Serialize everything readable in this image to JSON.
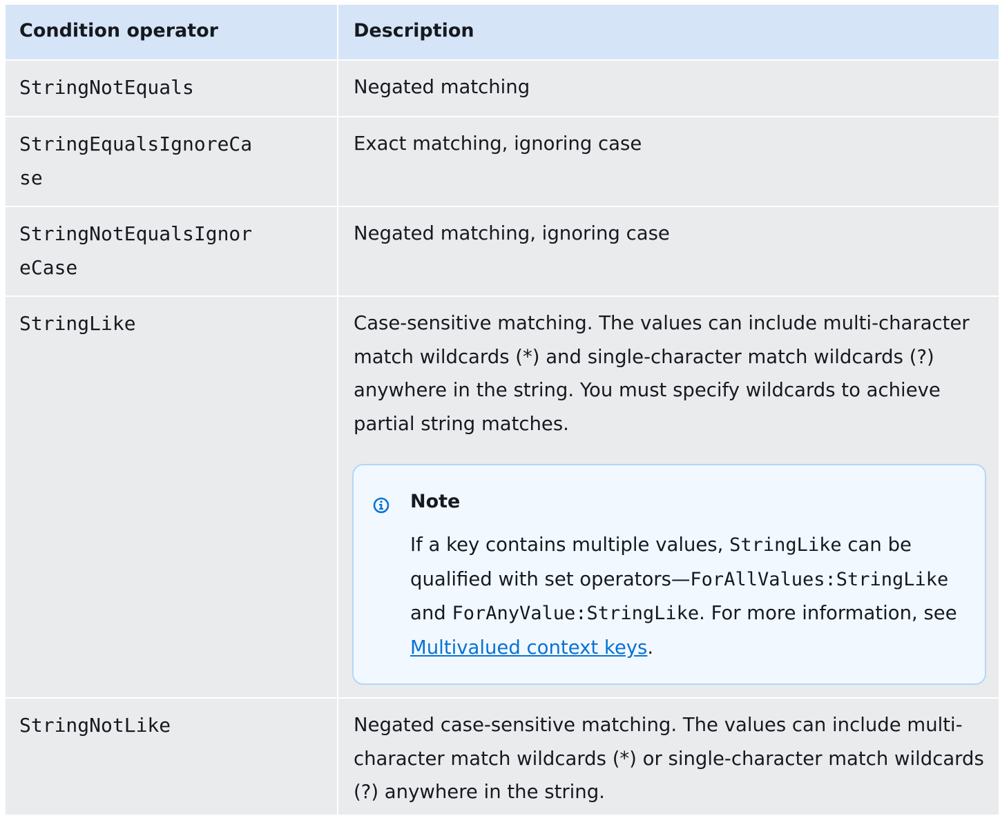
{
  "table": {
    "headers": {
      "operator": "Condition operator",
      "description": "Description"
    },
    "rows": [
      {
        "operator": "StringNotEquals",
        "description": "Negated matching"
      },
      {
        "operator": "StringEqualsIgnoreCase",
        "description": "Exact matching, ignoring case"
      },
      {
        "operator": "StringNotEqualsIgnoreCase",
        "description": "Negated matching, ignoring case"
      },
      {
        "operator": "StringLike",
        "description": "Case-sensitive matching. The values can include multi-character match wildcards (*) and single-character match wildcards (?) anywhere in the string. You must specify wildcards to achieve partial string matches.",
        "note": {
          "icon": "info-icon",
          "title": "Note",
          "text_1": "If a key contains multiple values, ",
          "code_1": "StringLike",
          "text_2": " can be qualified with set operators—",
          "code_2": "ForAllValues:StringLike",
          "text_3": " and ",
          "code_3": "ForAnyValue:StringLike",
          "text_4": ". For more information, see ",
          "link": "Multivalued context keys",
          "text_5": "."
        }
      },
      {
        "operator": "StringNotLike",
        "description": "Negated case-sensitive matching. The values can include multi-character match wildcards (*) or single-character match wildcards (?) anywhere in the string."
      }
    ]
  },
  "colors": {
    "header_bg": "#d5e5f7",
    "row_bg": "#eaebed",
    "note_bg": "#f1f8ff",
    "note_border": "#b5d6f4",
    "link": "#0972d3"
  }
}
